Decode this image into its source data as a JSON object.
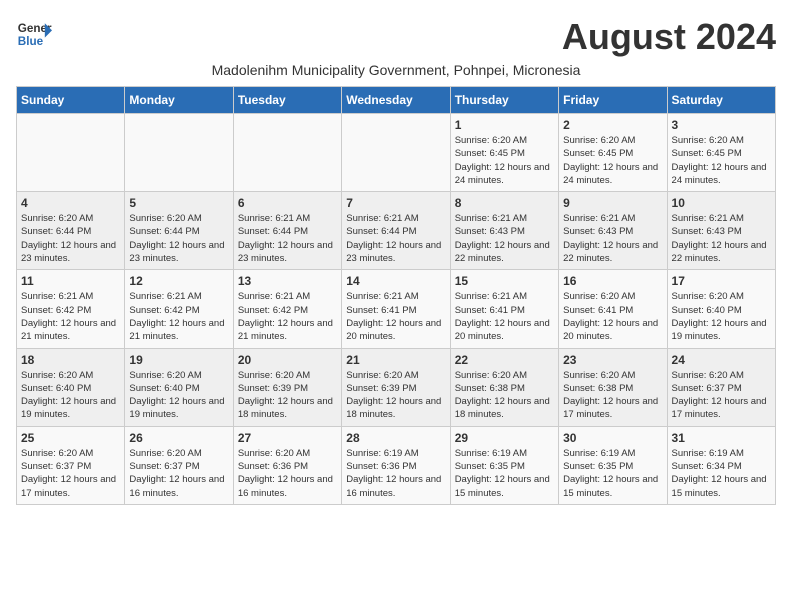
{
  "header": {
    "logo_general": "General",
    "logo_blue": "Blue",
    "month_year": "August 2024",
    "subtitle": "Madolenihm Municipality Government, Pohnpei, Micronesia"
  },
  "weekdays": [
    "Sunday",
    "Monday",
    "Tuesday",
    "Wednesday",
    "Thursday",
    "Friday",
    "Saturday"
  ],
  "weeks": [
    [
      {
        "day": "",
        "sunrise": "",
        "sunset": "",
        "daylight": ""
      },
      {
        "day": "",
        "sunrise": "",
        "sunset": "",
        "daylight": ""
      },
      {
        "day": "",
        "sunrise": "",
        "sunset": "",
        "daylight": ""
      },
      {
        "day": "",
        "sunrise": "",
        "sunset": "",
        "daylight": ""
      },
      {
        "day": "1",
        "sunrise": "Sunrise: 6:20 AM",
        "sunset": "Sunset: 6:45 PM",
        "daylight": "Daylight: 12 hours and 24 minutes."
      },
      {
        "day": "2",
        "sunrise": "Sunrise: 6:20 AM",
        "sunset": "Sunset: 6:45 PM",
        "daylight": "Daylight: 12 hours and 24 minutes."
      },
      {
        "day": "3",
        "sunrise": "Sunrise: 6:20 AM",
        "sunset": "Sunset: 6:45 PM",
        "daylight": "Daylight: 12 hours and 24 minutes."
      }
    ],
    [
      {
        "day": "4",
        "sunrise": "Sunrise: 6:20 AM",
        "sunset": "Sunset: 6:44 PM",
        "daylight": "Daylight: 12 hours and 23 minutes."
      },
      {
        "day": "5",
        "sunrise": "Sunrise: 6:20 AM",
        "sunset": "Sunset: 6:44 PM",
        "daylight": "Daylight: 12 hours and 23 minutes."
      },
      {
        "day": "6",
        "sunrise": "Sunrise: 6:21 AM",
        "sunset": "Sunset: 6:44 PM",
        "daylight": "Daylight: 12 hours and 23 minutes."
      },
      {
        "day": "7",
        "sunrise": "Sunrise: 6:21 AM",
        "sunset": "Sunset: 6:44 PM",
        "daylight": "Daylight: 12 hours and 23 minutes."
      },
      {
        "day": "8",
        "sunrise": "Sunrise: 6:21 AM",
        "sunset": "Sunset: 6:43 PM",
        "daylight": "Daylight: 12 hours and 22 minutes."
      },
      {
        "day": "9",
        "sunrise": "Sunrise: 6:21 AM",
        "sunset": "Sunset: 6:43 PM",
        "daylight": "Daylight: 12 hours and 22 minutes."
      },
      {
        "day": "10",
        "sunrise": "Sunrise: 6:21 AM",
        "sunset": "Sunset: 6:43 PM",
        "daylight": "Daylight: 12 hours and 22 minutes."
      }
    ],
    [
      {
        "day": "11",
        "sunrise": "Sunrise: 6:21 AM",
        "sunset": "Sunset: 6:42 PM",
        "daylight": "Daylight: 12 hours and 21 minutes."
      },
      {
        "day": "12",
        "sunrise": "Sunrise: 6:21 AM",
        "sunset": "Sunset: 6:42 PM",
        "daylight": "Daylight: 12 hours and 21 minutes."
      },
      {
        "day": "13",
        "sunrise": "Sunrise: 6:21 AM",
        "sunset": "Sunset: 6:42 PM",
        "daylight": "Daylight: 12 hours and 21 minutes."
      },
      {
        "day": "14",
        "sunrise": "Sunrise: 6:21 AM",
        "sunset": "Sunset: 6:41 PM",
        "daylight": "Daylight: 12 hours and 20 minutes."
      },
      {
        "day": "15",
        "sunrise": "Sunrise: 6:21 AM",
        "sunset": "Sunset: 6:41 PM",
        "daylight": "Daylight: 12 hours and 20 minutes."
      },
      {
        "day": "16",
        "sunrise": "Sunrise: 6:20 AM",
        "sunset": "Sunset: 6:41 PM",
        "daylight": "Daylight: 12 hours and 20 minutes."
      },
      {
        "day": "17",
        "sunrise": "Sunrise: 6:20 AM",
        "sunset": "Sunset: 6:40 PM",
        "daylight": "Daylight: 12 hours and 19 minutes."
      }
    ],
    [
      {
        "day": "18",
        "sunrise": "Sunrise: 6:20 AM",
        "sunset": "Sunset: 6:40 PM",
        "daylight": "Daylight: 12 hours and 19 minutes."
      },
      {
        "day": "19",
        "sunrise": "Sunrise: 6:20 AM",
        "sunset": "Sunset: 6:40 PM",
        "daylight": "Daylight: 12 hours and 19 minutes."
      },
      {
        "day": "20",
        "sunrise": "Sunrise: 6:20 AM",
        "sunset": "Sunset: 6:39 PM",
        "daylight": "Daylight: 12 hours and 18 minutes."
      },
      {
        "day": "21",
        "sunrise": "Sunrise: 6:20 AM",
        "sunset": "Sunset: 6:39 PM",
        "daylight": "Daylight: 12 hours and 18 minutes."
      },
      {
        "day": "22",
        "sunrise": "Sunrise: 6:20 AM",
        "sunset": "Sunset: 6:38 PM",
        "daylight": "Daylight: 12 hours and 18 minutes."
      },
      {
        "day": "23",
        "sunrise": "Sunrise: 6:20 AM",
        "sunset": "Sunset: 6:38 PM",
        "daylight": "Daylight: 12 hours and 17 minutes."
      },
      {
        "day": "24",
        "sunrise": "Sunrise: 6:20 AM",
        "sunset": "Sunset: 6:37 PM",
        "daylight": "Daylight: 12 hours and 17 minutes."
      }
    ],
    [
      {
        "day": "25",
        "sunrise": "Sunrise: 6:20 AM",
        "sunset": "Sunset: 6:37 PM",
        "daylight": "Daylight: 12 hours and 17 minutes."
      },
      {
        "day": "26",
        "sunrise": "Sunrise: 6:20 AM",
        "sunset": "Sunset: 6:37 PM",
        "daylight": "Daylight: 12 hours and 16 minutes."
      },
      {
        "day": "27",
        "sunrise": "Sunrise: 6:20 AM",
        "sunset": "Sunset: 6:36 PM",
        "daylight": "Daylight: 12 hours and 16 minutes."
      },
      {
        "day": "28",
        "sunrise": "Sunrise: 6:19 AM",
        "sunset": "Sunset: 6:36 PM",
        "daylight": "Daylight: 12 hours and 16 minutes."
      },
      {
        "day": "29",
        "sunrise": "Sunrise: 6:19 AM",
        "sunset": "Sunset: 6:35 PM",
        "daylight": "Daylight: 12 hours and 15 minutes."
      },
      {
        "day": "30",
        "sunrise": "Sunrise: 6:19 AM",
        "sunset": "Sunset: 6:35 PM",
        "daylight": "Daylight: 12 hours and 15 minutes."
      },
      {
        "day": "31",
        "sunrise": "Sunrise: 6:19 AM",
        "sunset": "Sunset: 6:34 PM",
        "daylight": "Daylight: 12 hours and 15 minutes."
      }
    ]
  ]
}
